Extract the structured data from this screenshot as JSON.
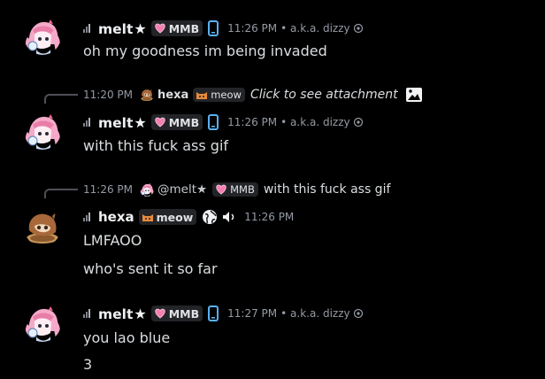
{
  "colors": {
    "background": "#000000",
    "time": "#949ba4",
    "text": "#dbdee1",
    "phone": "#5ab1f0",
    "heart": "#f47fb0"
  },
  "messages": [
    {
      "author": "melt",
      "badge": "MMB",
      "time": "11:26 PM",
      "aka": "• a.k.a. dizzy",
      "lines": [
        "oh my goodness im being invaded"
      ]
    },
    {
      "reply": {
        "time": "11:20 PM",
        "author": "hexa",
        "tag": "meow",
        "text": "Click to see attachment"
      },
      "author": "melt",
      "badge": "MMB",
      "time": "11:26 PM",
      "aka": "• a.k.a. dizzy",
      "lines": [
        "with this fuck ass gif"
      ]
    },
    {
      "reply": {
        "time": "11:26 PM",
        "author": "@melt",
        "tag": "MMB",
        "text": "with this fuck ass gif"
      },
      "author": "hexa",
      "badge": "meow",
      "time": "11:26 PM",
      "lines": [
        "LMFAOO",
        "who's sent it so far"
      ]
    },
    {
      "author": "melt",
      "badge": "MMB",
      "time": "11:27 PM",
      "aka": "• a.k.a. dizzy",
      "lines": [
        "you lao blue",
        "3"
      ]
    }
  ]
}
